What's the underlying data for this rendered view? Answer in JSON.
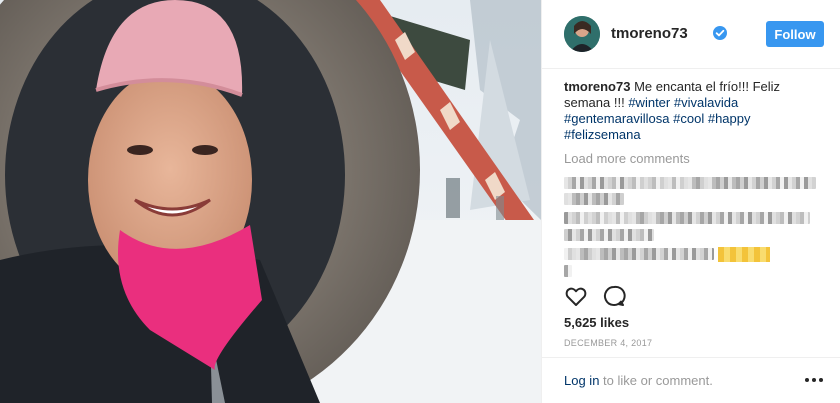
{
  "post": {
    "username": "tmoreno73",
    "follow_label": "Follow",
    "caption": {
      "username": "tmoreno73",
      "text": "Me encanta el frío!!! Feliz semana !!!",
      "hashtags": [
        "#winter",
        "#vivalavida",
        "#gentemaravillosa",
        "#cool",
        "#happy",
        "#felizsemana"
      ]
    },
    "load_more_label": "Load more comments",
    "likes_text": "5,625 likes",
    "date": "DECEMBER 4, 2017",
    "login": {
      "link": "Log in",
      "rest": "to like or comment."
    }
  },
  "icons": {
    "verified": "verified-badge-icon",
    "like": "heart-outline-icon",
    "comment": "comment-bubble-icon",
    "more": "more-dots-icon"
  },
  "colors": {
    "accent": "#3897f0",
    "hashtag": "#003569",
    "muted": "#999999",
    "text": "#262626",
    "border": "#efefef"
  }
}
